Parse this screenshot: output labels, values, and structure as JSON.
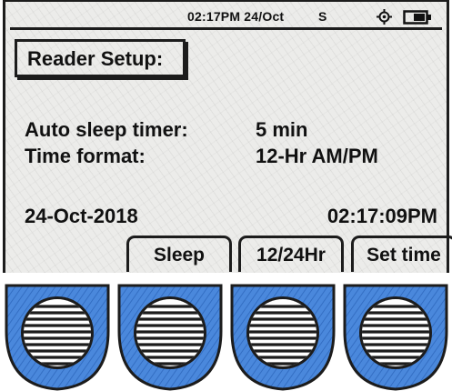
{
  "status_bar": {
    "time_date": "02:17PM 24/Oct",
    "indicator": "S",
    "icons": [
      "gps-icon",
      "battery-icon"
    ]
  },
  "screen": {
    "title": "Reader Setup:",
    "settings": [
      {
        "label": "Auto sleep timer:",
        "value": "5 min"
      },
      {
        "label": "Time format:",
        "value": "12-Hr AM/PM"
      }
    ],
    "date": "24-Oct-2018",
    "time": "02:17:09PM"
  },
  "softkeys": [
    {
      "label": "Sleep"
    },
    {
      "label": "12/24Hr"
    },
    {
      "label": "Set time"
    }
  ],
  "hardware_keys": {
    "count": 4,
    "icon": "striped-circle-key-icon",
    "color": "#3f7fd6"
  },
  "colors": {
    "screen_bg": "#ececea",
    "ink": "#1c1c1c",
    "key_blue": "#3f7fd6"
  }
}
